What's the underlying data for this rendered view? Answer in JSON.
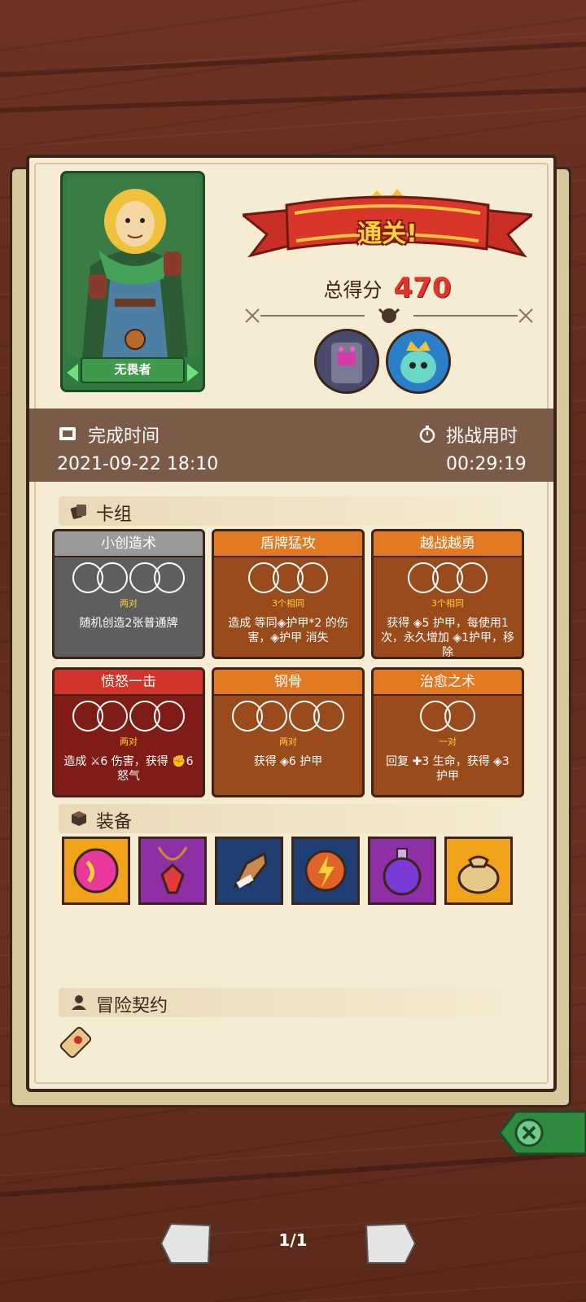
{
  "hero": {
    "name": "无畏者"
  },
  "banner": {
    "title": "通关!"
  },
  "score": {
    "label": "总得分",
    "value": "470"
  },
  "bosses": [
    {
      "name": "stone-golem-boss"
    },
    {
      "name": "crowned-ghost-boss"
    }
  ],
  "time": {
    "complete_label": "完成时间",
    "complete_value": "2021-09-22 18:10",
    "challenge_label": "挑战用时",
    "challenge_value": "00:29:19"
  },
  "deck": {
    "label": "卡组",
    "cards": [
      {
        "title": "小创造术",
        "style": "gray",
        "sub": "两对",
        "desc": "随机创造2张普通牌"
      },
      {
        "title": "盾牌猛攻",
        "style": "brown",
        "sub": "3个相同",
        "desc": "造成 等同◈护甲*2 的伤害，◈护甲 消失"
      },
      {
        "title": "越战越勇",
        "style": "brown",
        "sub": "3个相同",
        "desc": "获得 ◈5 护甲，每使用1次，永久增加 ◈1护甲，移除"
      },
      {
        "title": "愤怒一击",
        "style": "red",
        "sub": "两对",
        "desc": "造成 ⚔6 伤害，获得 ✊6 怒气"
      },
      {
        "title": "钢骨",
        "style": "brown",
        "sub": "两对",
        "desc": "获得 ◈6 护甲"
      },
      {
        "title": "治愈之术",
        "style": "brown",
        "sub": "一对",
        "desc": "回复 ✚3 生命，获得 ◈3 护甲"
      }
    ]
  },
  "equipment": {
    "label": "装备",
    "items": [
      {
        "name": "pink-orb",
        "bg": "#f0a21a"
      },
      {
        "name": "red-gem-amulet",
        "bg": "#8f2fa6"
      },
      {
        "name": "drum-horn",
        "bg": "#1f3f73"
      },
      {
        "name": "lightning-orb",
        "bg": "#1f3f73"
      },
      {
        "name": "purple-potion",
        "bg": "#8f2fa6"
      },
      {
        "name": "gold-sack",
        "bg": "#f0a21a"
      }
    ]
  },
  "contract": {
    "label": "冒险契约"
  },
  "pager": {
    "text": "1/1"
  },
  "colors": {
    "accent_red": "#e0352a",
    "paper": "#f6ecd3",
    "wood": "#5c2a1b"
  }
}
